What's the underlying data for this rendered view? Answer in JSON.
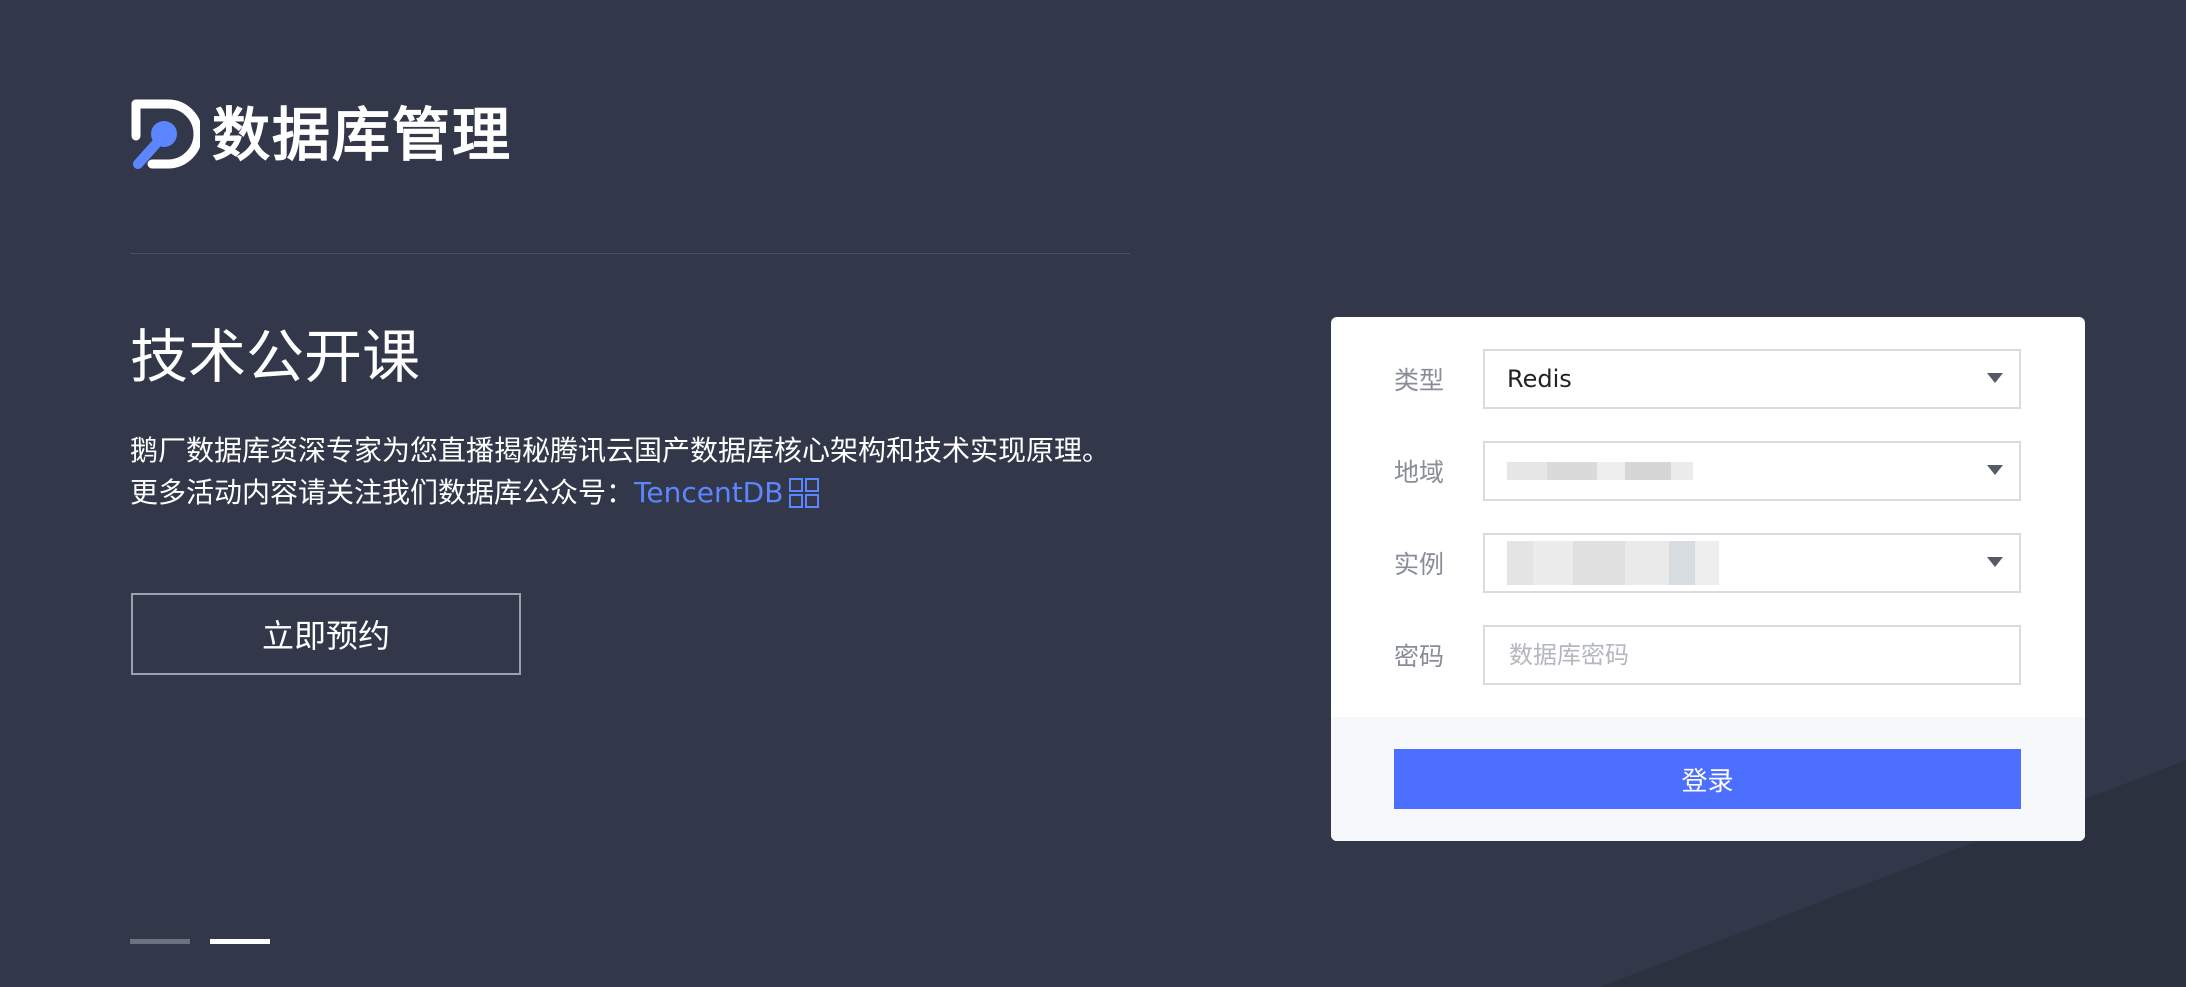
{
  "colors": {
    "background": "#323849",
    "accent": "#4d6fff",
    "link": "#5c86ff",
    "logo_accent": "#5c86ff"
  },
  "brand": {
    "logo_icon": "database-management-logo-icon",
    "title": "数据库管理"
  },
  "promo": {
    "headline": "技术公开课",
    "description_line1": "鹅厂数据库资深专家为您直播揭秘腾讯云国产数据库核心架构和技术实现原理。",
    "description_line2_prefix": "更多活动内容请关注我们数据库公众号：",
    "wechat_account": "TencentDB",
    "qr_icon": "qrcode-icon",
    "reserve_button": "立即预约"
  },
  "carousel": {
    "total_slides": 2,
    "active_index": 1
  },
  "login_form": {
    "type_label": "类型",
    "type_value": "Redis",
    "region_label": "地域",
    "region_value": "",
    "instance_label": "实例",
    "instance_value": "",
    "password_label": "密码",
    "password_placeholder": "数据库密码",
    "submit_label": "登录"
  }
}
